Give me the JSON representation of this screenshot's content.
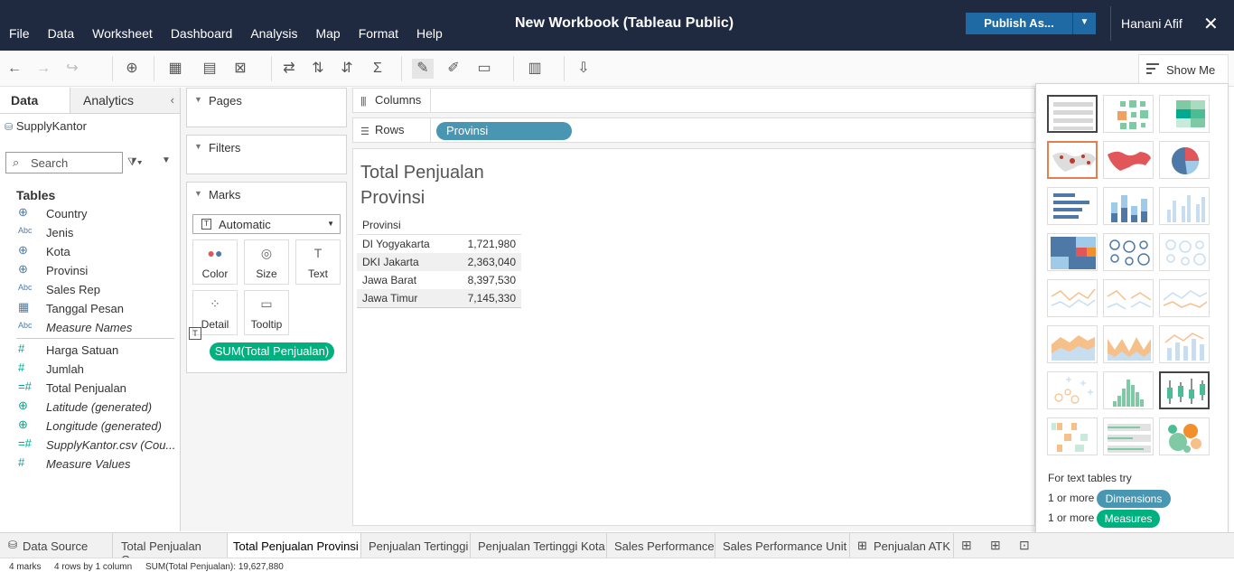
{
  "app": {
    "title": "New Workbook (Tableau Public)",
    "menu": [
      "File",
      "Data",
      "Worksheet",
      "Dashboard",
      "Analysis",
      "Map",
      "Format",
      "Help"
    ],
    "publish_label": "Publish As...",
    "user": "Hanani Afif"
  },
  "toolbar": {
    "show_me_label": "Show Me"
  },
  "left_pane": {
    "tab_data": "Data",
    "tab_analytics": "Analytics",
    "datasource": "SupplyKantor",
    "search_placeholder": "Search",
    "tables_heading": "Tables",
    "dimensions": [
      {
        "name": "Country",
        "icon": "globe-icon",
        "type_label": ""
      },
      {
        "name": "Jenis",
        "icon": "abc-icon",
        "type_label": "Abc"
      },
      {
        "name": "Kota",
        "icon": "globe-icon",
        "type_label": ""
      },
      {
        "name": "Provinsi",
        "icon": "globe-icon",
        "type_label": ""
      },
      {
        "name": "Sales Rep",
        "icon": "abc-icon",
        "type_label": "Abc"
      },
      {
        "name": "Tanggal Pesan",
        "icon": "calendar-icon",
        "type_label": ""
      },
      {
        "name": "Measure Names",
        "icon": "abc-icon",
        "type_label": "Abc"
      }
    ],
    "measures": [
      {
        "name": "Harga Satuan",
        "icon": "number-icon"
      },
      {
        "name": "Jumlah",
        "icon": "number-icon"
      },
      {
        "name": "Total Penjualan",
        "icon": "number-icon"
      },
      {
        "name": "Latitude (generated)",
        "icon": "globe-measure-icon"
      },
      {
        "name": "Longitude (generated)",
        "icon": "globe-measure-icon"
      },
      {
        "name": "SupplyKantor.csv (Cou...",
        "icon": "number-icon"
      },
      {
        "name": "Measure Values",
        "icon": "number-icon"
      }
    ]
  },
  "cards": {
    "pages": "Pages",
    "filters": "Filters",
    "marks": "Marks",
    "mark_type": "Automatic",
    "mark_buttons": [
      "Color",
      "Size",
      "Text",
      "Detail",
      "Tooltip"
    ],
    "text_pill": "SUM(Total Penjualan)"
  },
  "shelves": {
    "columns_label": "Columns",
    "rows_label": "Rows",
    "rows_pill": "Provinsi"
  },
  "view": {
    "title_line1": "Total Penjualan",
    "title_line2": "Provinsi",
    "column_header": "Provinsi",
    "rows": [
      {
        "provinsi": "DI Yogyakarta",
        "value": "1,721,980"
      },
      {
        "provinsi": "DKI Jakarta",
        "value": "2,363,040"
      },
      {
        "provinsi": "Jawa Barat",
        "value": "8,397,530"
      },
      {
        "provinsi": "Jawa Timur",
        "value": "7,145,330"
      }
    ]
  },
  "show_me": {
    "hint": "For text tables try",
    "req1_prefix": "1 or more",
    "req1_pill": "Dimensions",
    "req2_prefix": "1 or more",
    "req2_pill": "Measures"
  },
  "sheet_tabs": {
    "data_source": "Data Source",
    "sheets": [
      "Total Penjualan Geo",
      "Total Penjualan Provinsi",
      "Penjualan Tertinggi",
      "Penjualan Tertinggi Kota",
      "Sales Performance",
      "Sales Performance Unit",
      "Penjualan ATK"
    ]
  },
  "status": {
    "marks": "4 marks",
    "rows_cols": "4 rows by 1 column",
    "sum": "SUM(Total Penjualan): 19,627,880"
  },
  "colors": {
    "titlebar": "#1f2940",
    "publish": "#1f6aa5",
    "dimension_pill": "#4996b2",
    "measure_pill": "#00b180"
  }
}
